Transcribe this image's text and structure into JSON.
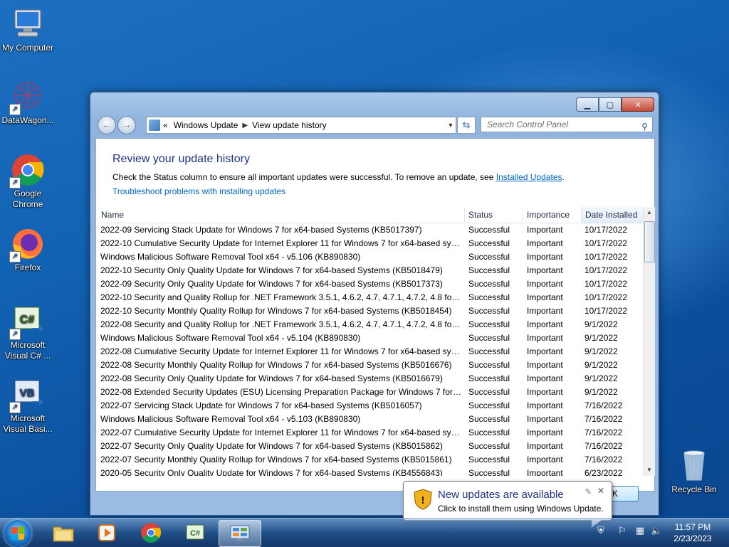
{
  "desktop": {
    "icons": [
      {
        "label": "My Computer"
      },
      {
        "label": "DataWagon..."
      },
      {
        "label": "Google Chrome"
      },
      {
        "label": "Firefox"
      },
      {
        "label": "Microsoft Visual C# ..."
      },
      {
        "label": "Microsoft Visual Basi..."
      },
      {
        "label": "Recycle Bin"
      }
    ]
  },
  "window": {
    "breadcrumb": [
      "Windows Update",
      "View update history"
    ],
    "search_placeholder": "Search Control Panel",
    "heading": "Review your update history",
    "desc_before": "Check the Status column to ensure all important updates were successful. To remove an update, see ",
    "desc_link": "Installed Updates",
    "desc_after": ".",
    "troubleshoot_link": "Troubleshoot problems with installing updates",
    "columns": [
      "Name",
      "Status",
      "Importance",
      "Date Installed"
    ],
    "rows": [
      {
        "name": "2022-09 Servicing Stack Update for Windows 7 for x64-based Systems (KB5017397)",
        "status": "Successful",
        "importance": "Important",
        "date": "10/17/2022"
      },
      {
        "name": "2022-10 Cumulative Security Update for Internet Explorer 11 for Windows 7 for x64-based syste...",
        "status": "Successful",
        "importance": "Important",
        "date": "10/17/2022"
      },
      {
        "name": "Windows Malicious Software Removal Tool x64 - v5.106 (KB890830)",
        "status": "Successful",
        "importance": "Important",
        "date": "10/17/2022"
      },
      {
        "name": "2022-10 Security Only Quality Update for Windows 7 for x64-based Systems (KB5018479)",
        "status": "Successful",
        "importance": "Important",
        "date": "10/17/2022"
      },
      {
        "name": "2022-09 Security Only Quality Update for Windows 7 for x64-based Systems (KB5017373)",
        "status": "Successful",
        "importance": "Important",
        "date": "10/17/2022"
      },
      {
        "name": "2022-10 Security and Quality Rollup for .NET Framework 3.5.1, 4.6.2, 4.7, 4.7.1, 4.7.2, 4.8 for Win...",
        "status": "Successful",
        "importance": "Important",
        "date": "10/17/2022"
      },
      {
        "name": "2022-10 Security Monthly Quality Rollup for Windows 7 for x64-based Systems (KB5018454)",
        "status": "Successful",
        "importance": "Important",
        "date": "10/17/2022"
      },
      {
        "name": "2022-08 Security and Quality Rollup for .NET Framework 3.5.1, 4.6.2, 4.7, 4.7.1, 4.7.2, 4.8 for Win...",
        "status": "Successful",
        "importance": "Important",
        "date": "9/1/2022"
      },
      {
        "name": "Windows Malicious Software Removal Tool x64 - v5.104 (KB890830)",
        "status": "Successful",
        "importance": "Important",
        "date": "9/1/2022"
      },
      {
        "name": "2022-08 Cumulative Security Update for Internet Explorer 11 for Windows 7 for x64-based syste...",
        "status": "Successful",
        "importance": "Important",
        "date": "9/1/2022"
      },
      {
        "name": "2022-08 Security Monthly Quality Rollup for Windows 7 for x64-based Systems (KB5016676)",
        "status": "Successful",
        "importance": "Important",
        "date": "9/1/2022"
      },
      {
        "name": "2022-08 Security Only Quality Update for Windows 7 for x64-based Systems (KB5016679)",
        "status": "Successful",
        "importance": "Important",
        "date": "9/1/2022"
      },
      {
        "name": "2022-08 Extended Security Updates (ESU) Licensing Preparation Package for Windows 7 for x64-...",
        "status": "Successful",
        "importance": "Important",
        "date": "9/1/2022"
      },
      {
        "name": "2022-07 Servicing Stack Update for Windows 7 for x64-based Systems (KB5016057)",
        "status": "Successful",
        "importance": "Important",
        "date": "7/16/2022"
      },
      {
        "name": "Windows Malicious Software Removal Tool x64 - v5.103 (KB890830)",
        "status": "Successful",
        "importance": "Important",
        "date": "7/16/2022"
      },
      {
        "name": "2022-07 Cumulative Security Update for Internet Explorer 11 for Windows 7 for x64-based syste...",
        "status": "Successful",
        "importance": "Important",
        "date": "7/16/2022"
      },
      {
        "name": "2022-07 Security Only Quality Update for Windows 7 for x64-based Systems (KB5015862)",
        "status": "Successful",
        "importance": "Important",
        "date": "7/16/2022"
      },
      {
        "name": "2022-07 Security Monthly Quality Rollup for Windows 7 for x64-based Systems (KB5015861)",
        "status": "Successful",
        "importance": "Important",
        "date": "7/16/2022"
      },
      {
        "name": "2020-05 Security Only Quality Update for Windows 7 for x64-based Systems (KB4556843)",
        "status": "Successful",
        "importance": "Important",
        "date": "6/23/2022"
      }
    ],
    "ok_label": "OK"
  },
  "notification": {
    "title": "New updates are available",
    "message": "Click to install them using Windows Update."
  },
  "taskbar": {
    "time": "11:57 PM",
    "date": "2/23/2023"
  },
  "colors": {
    "heading_blue": "#1e3287",
    "link_blue": "#0066cc"
  }
}
